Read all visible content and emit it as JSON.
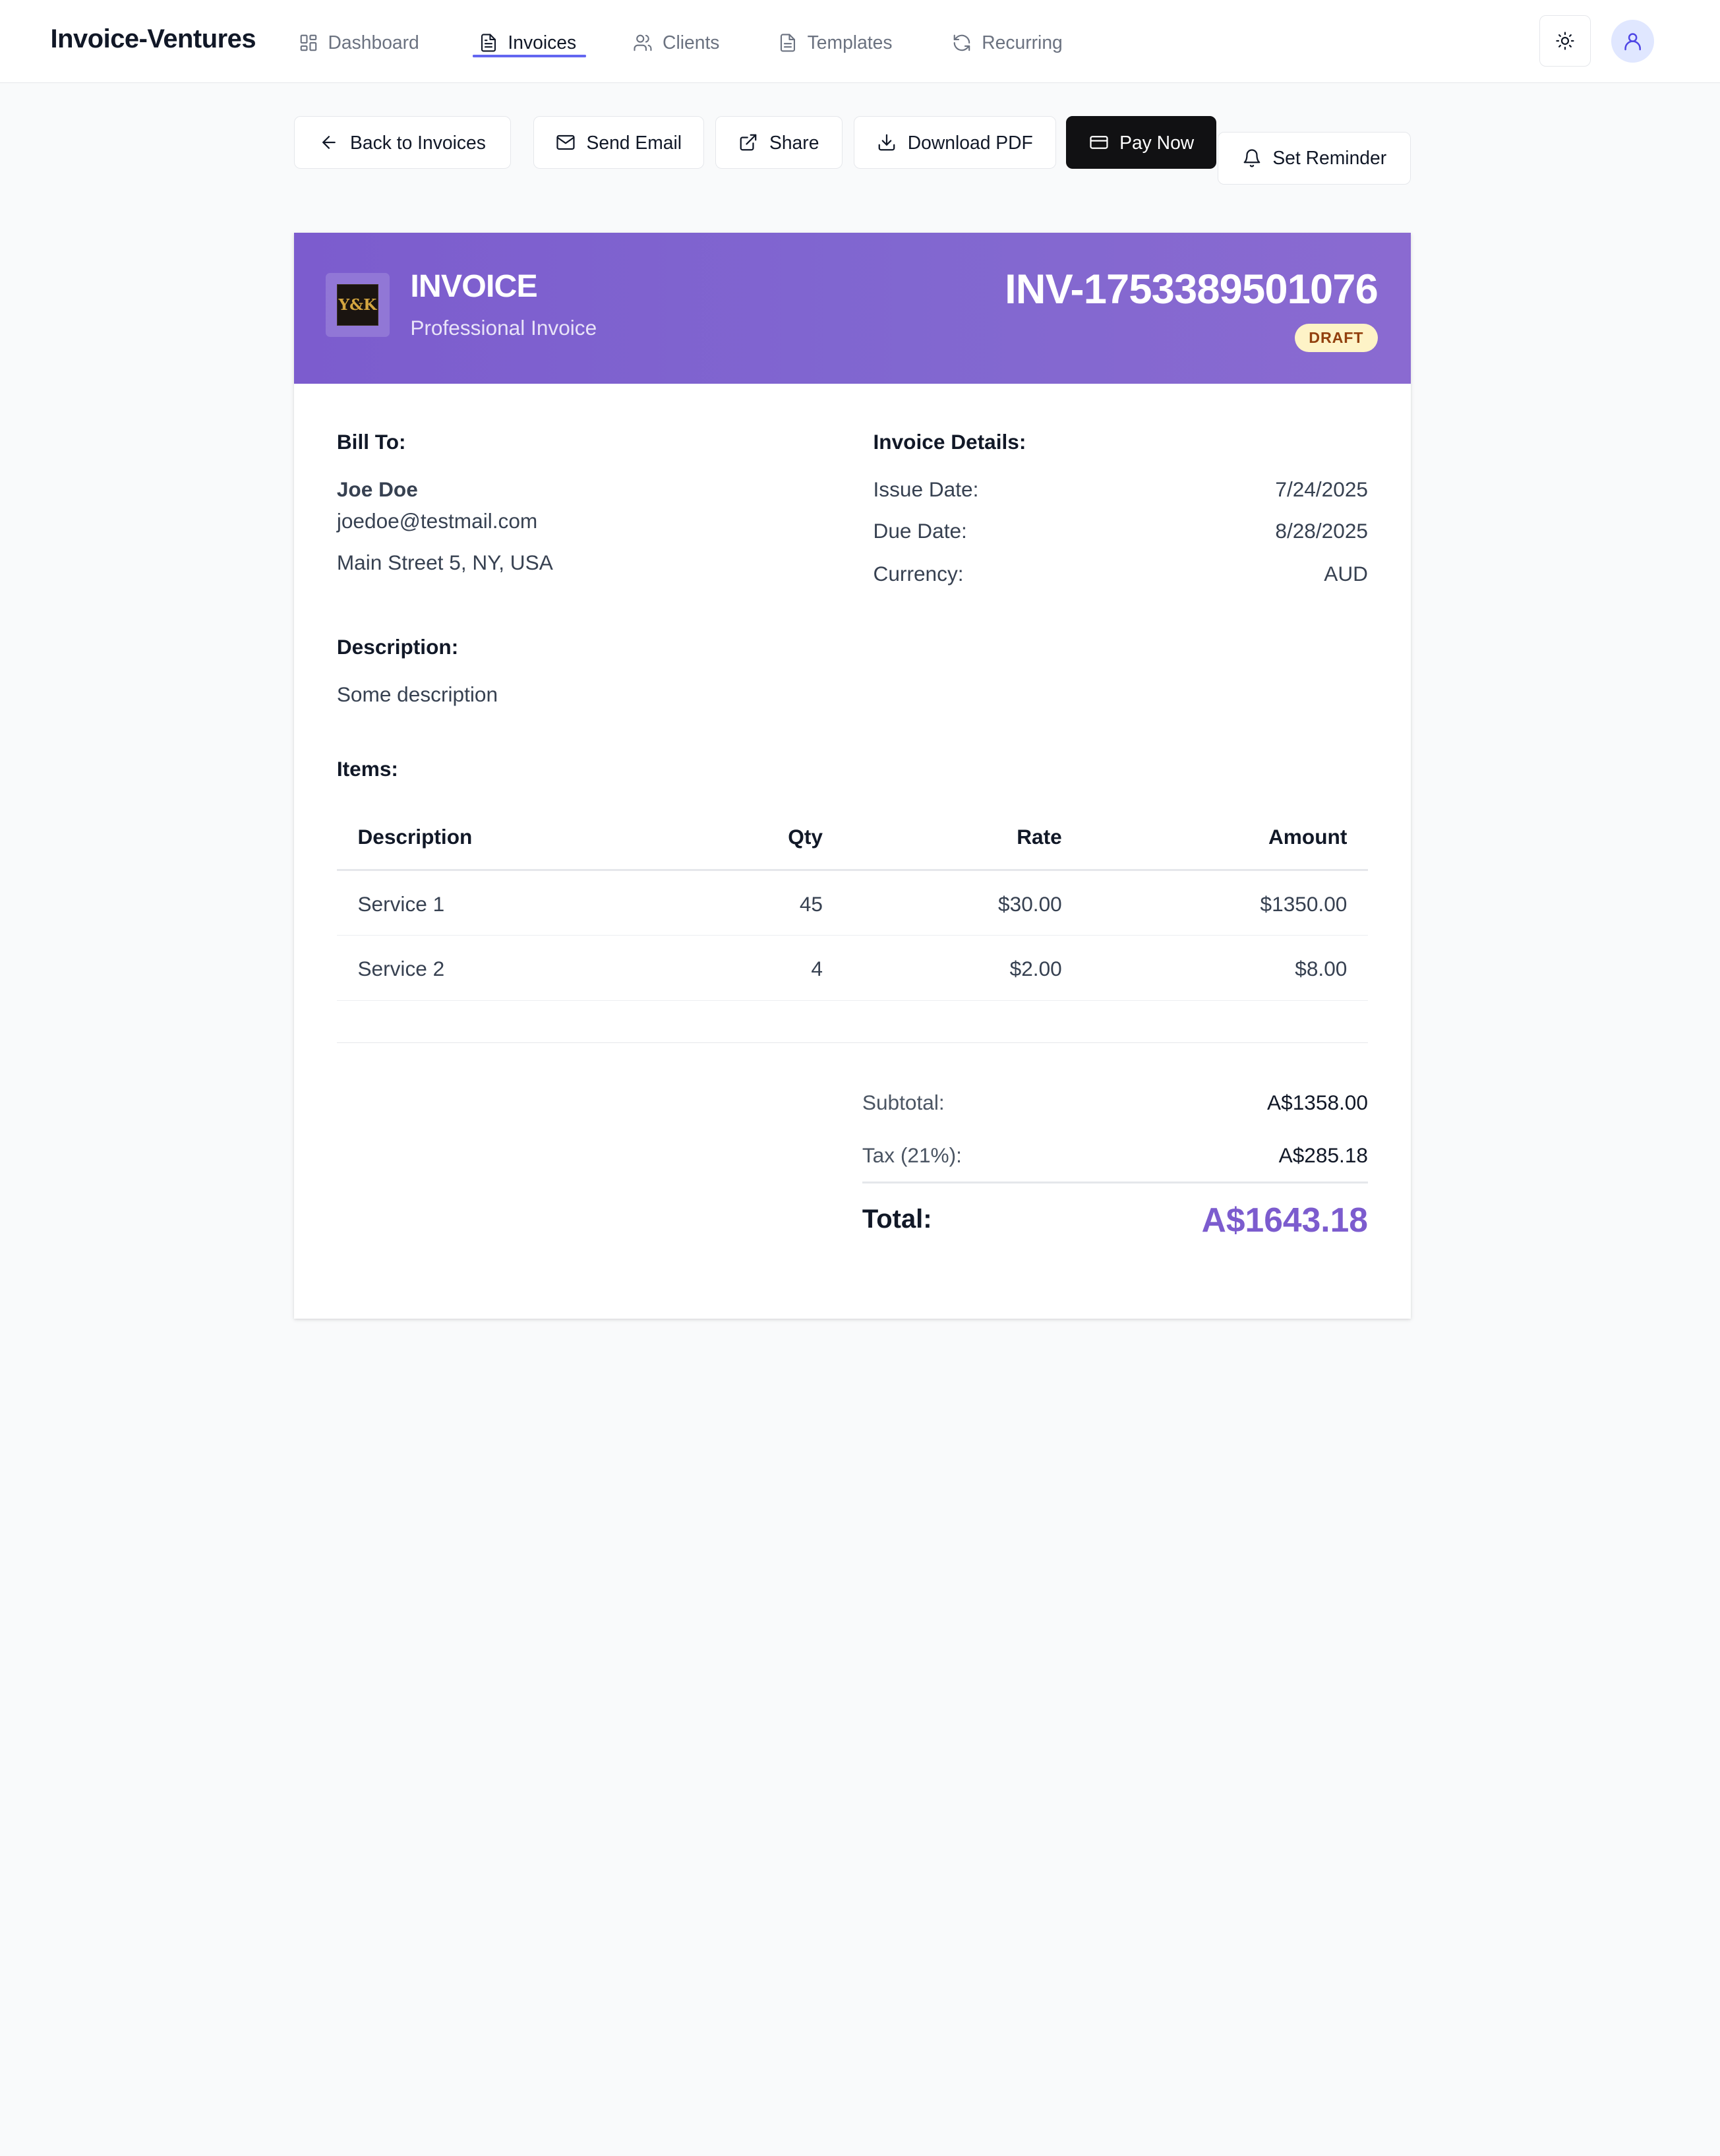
{
  "app": {
    "brand": "Invoice-Ventures",
    "accent_color": "#6366f1",
    "header_gradient": [
      "#7c5cce",
      "#8a6ad1"
    ]
  },
  "nav": {
    "items": [
      {
        "label": "Dashboard",
        "icon": "grid-icon"
      },
      {
        "label": "Invoices",
        "icon": "document-icon",
        "active": true
      },
      {
        "label": "Clients",
        "icon": "users-icon"
      },
      {
        "label": "Templates",
        "icon": "file-icon"
      },
      {
        "label": "Recurring",
        "icon": "refresh-icon"
      }
    ],
    "theme_icon": "sun-icon",
    "user_icon": "user-icon"
  },
  "toolbar": {
    "back_label": "Back to Invoices",
    "send_email_label": "Send Email",
    "share_label": "Share",
    "download_label": "Download PDF",
    "pay_now_label": "Pay Now",
    "reminder_label": "Set Reminder"
  },
  "invoice": {
    "logo_text": "Y&K",
    "title": "INVOICE",
    "subtitle": "Professional Invoice",
    "number": "INV-1753389501076",
    "status": "DRAFT",
    "bill_to": {
      "heading": "Bill To:",
      "name": "Joe Doe",
      "email": "joedoe@testmail.com",
      "address": "Main Street 5, NY, USA"
    },
    "details": {
      "heading": "Invoice Details:",
      "issue_label": "Issue Date:",
      "issue_value": "7/24/2025",
      "due_label": "Due Date:",
      "due_value": "8/28/2025",
      "currency_label": "Currency:",
      "currency_value": "AUD"
    },
    "description": {
      "heading": "Description:",
      "text": "Some description"
    },
    "items": {
      "heading": "Items:",
      "columns": [
        "Description",
        "Qty",
        "Rate",
        "Amount"
      ],
      "rows": [
        {
          "description": "Service 1",
          "qty": "45",
          "rate": "$30.00",
          "amount": "$1350.00"
        },
        {
          "description": "Service 2",
          "qty": "4",
          "rate": "$2.00",
          "amount": "$8.00"
        }
      ]
    },
    "totals": {
      "subtotal_label": "Subtotal:",
      "subtotal_value": "A$1358.00",
      "tax_label": "Tax (21%):",
      "tax_value": "A$285.18",
      "total_label": "Total:",
      "total_value": "A$1643.18"
    }
  }
}
